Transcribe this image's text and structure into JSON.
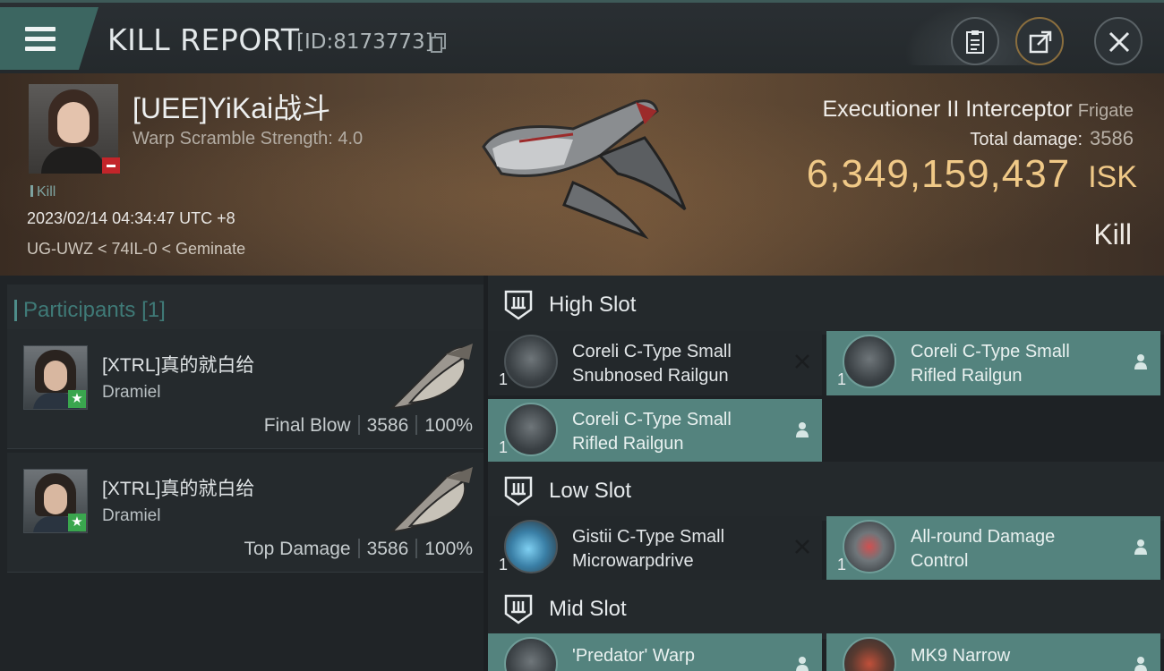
{
  "header": {
    "title": "KILL REPORT",
    "kill_id": "[ID:8173773]"
  },
  "victim": {
    "pilot_name": "[UEE]YiKai战斗",
    "scramble": "Warp Scramble Strength: 4.0",
    "kill_tag": "Kill",
    "datetime": "2023/02/14 04:34:47 UTC +8",
    "location": "UG-UWZ < 74IL-0 < Geminate",
    "ship_name": "Executioner II Interceptor",
    "ship_class": "Frigate",
    "total_damage_label": "Total damage:",
    "total_damage_value": "3586",
    "isk_value": "6,349,159,437",
    "isk_unit": "ISK",
    "result": "Kill"
  },
  "participants": {
    "title": "Participants",
    "count": "[1]",
    "cards": [
      {
        "name": "[XTRL]真的就白给",
        "ship": "Dramiel",
        "role": "Final Blow",
        "damage": "3586",
        "percent": "100%"
      },
      {
        "name": "[XTRL]真的就白给",
        "ship": "Dramiel",
        "role": "Top Damage",
        "damage": "3586",
        "percent": "100%"
      }
    ]
  },
  "slots": {
    "high": {
      "title": "High Slot",
      "modules": [
        {
          "name_line1": "Coreli C-Type Small",
          "name_line2": "Snubnosed Railgun",
          "qty": "1",
          "status": "destroyed"
        },
        {
          "name_line1": "Coreli C-Type Small",
          "name_line2": "Rifled Railgun",
          "qty": "1",
          "status": "dropped"
        },
        {
          "name_line1": "Coreli C-Type Small",
          "name_line2": "Rifled Railgun",
          "qty": "1",
          "status": "dropped"
        }
      ]
    },
    "low": {
      "title": "Low Slot",
      "modules": [
        {
          "name_line1": "Gistii C-Type Small",
          "name_line2": "Microwarpdrive",
          "qty": "1",
          "status": "destroyed"
        },
        {
          "name_line1": "All-round Damage",
          "name_line2": "Control",
          "qty": "1",
          "status": "dropped"
        }
      ]
    },
    "mid": {
      "title": "Mid Slot",
      "modules": [
        {
          "name_line1": "'Predator' Warp",
          "status": "dropped"
        },
        {
          "name_line1": "MK9 Narrow",
          "status": "dropped"
        }
      ]
    }
  },
  "colors": {
    "accent_teal": "#54837e",
    "isk_gold": "#f0c987",
    "badge_red": "#c2252a",
    "badge_green": "#3aa64e"
  },
  "icons": [
    "menu-icon",
    "copy-icon",
    "clipboard-icon",
    "share-icon",
    "close-icon",
    "slot-icon",
    "destroyed-x-icon",
    "dropped-person-icon",
    "star-icon"
  ]
}
